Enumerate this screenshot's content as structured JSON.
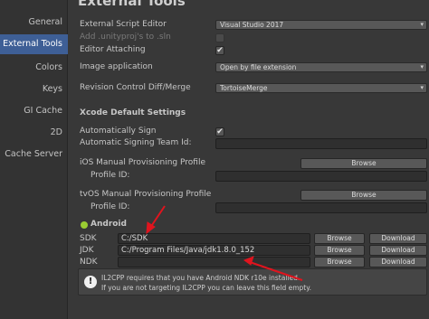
{
  "sidebar": {
    "items": [
      {
        "label": "General"
      },
      {
        "label": "External Tools"
      },
      {
        "label": "Colors"
      },
      {
        "label": "Keys"
      },
      {
        "label": "GI Cache"
      },
      {
        "label": "2D"
      },
      {
        "label": "Cache Server"
      }
    ]
  },
  "main": {
    "title": "External Tools",
    "external_script_editor_label": "External Script Editor",
    "external_script_editor_value": "Visual Studio 2017",
    "add_unityproj_label": "Add .unityproj's to .sln",
    "editor_attaching_label": "Editor Attaching",
    "image_application_label": "Image application",
    "image_application_value": "Open by file extension",
    "revision_control_label": "Revision Control Diff/Merge",
    "revision_control_value": "TortoiseMerge",
    "xcode_header": "Xcode Default Settings",
    "auto_sign_label": "Automatically Sign",
    "auto_signing_team_label": "Automatic Signing Team Id:",
    "ios_profile_label": "iOS Manual Provisioning Profile",
    "ios_profile_id_label": "Profile ID:",
    "tvos_profile_label": "tvOS Manual Provisioning Profile",
    "tvos_profile_id_label": "Profile ID:",
    "browse_label": "Browse",
    "download_label": "Download",
    "android_header": "Android",
    "sdk_label": "SDK",
    "sdk_value": "C:/SDK",
    "jdk_label": "JDK",
    "jdk_value": "C:/Program Files/Java/jdk1.8.0_152",
    "ndk_label": "NDK",
    "ndk_value": "",
    "help_line1": "IL2CPP requires that you have Android NDK r10e installed.",
    "help_line2": "If you are not targeting IL2CPP you can leave this field empty.",
    "help_icon": "!"
  },
  "icons": {
    "dropdown_arrow": "▾",
    "check": "✔"
  },
  "colors": {
    "selected_sidebar": "#3e5f96",
    "annotation_arrow": "#e0141e"
  }
}
